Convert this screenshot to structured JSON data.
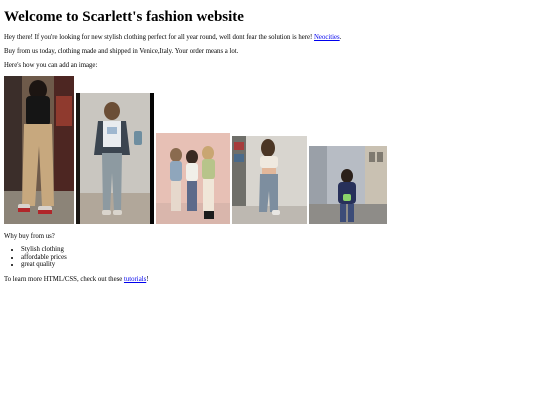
{
  "title": "Welcome to Scarlett's fashion website",
  "intro": {
    "text_before": "Hey there! If you're looking for new stylish clothing perfect for all year round, well dont fear the solution is here! ",
    "link_text": "Neocities",
    "text_after": "."
  },
  "buy_text": "Buy from us today, clothing made and shipped in Venice,Italy. Your order means a lot.",
  "image_intro": "Here's how you can add an image:",
  "images": [
    {
      "name": "outfit-photo-1",
      "subject": "person in black top and tan trousers with red sneakers"
    },
    {
      "name": "outfit-photo-2",
      "subject": "person in white tee, plaid shirt and grey jeans"
    },
    {
      "name": "outfit-photo-3",
      "subject": "three friends posing in casual outfits"
    },
    {
      "name": "outfit-photo-4",
      "subject": "person in cropped top and jeans in a store"
    },
    {
      "name": "outfit-photo-5",
      "subject": "person in navy hoodie on a city street"
    }
  ],
  "why_heading": "Why buy from us?",
  "reasons": [
    "Stylish clothing",
    "affordable prices",
    "great quality"
  ],
  "learn_more": {
    "text_before": "To learn more HTML/CSS, check out these ",
    "link_text": "tutorials",
    "text_after": "!"
  },
  "colors": {
    "link": "#0000ee",
    "text": "#000000",
    "background": "#ffffff"
  }
}
